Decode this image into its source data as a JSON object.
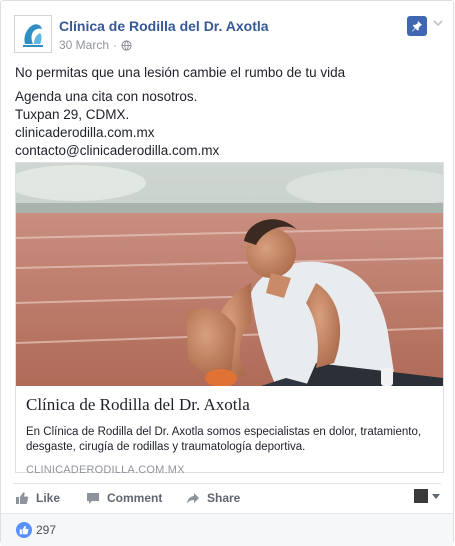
{
  "post": {
    "page_name": "Clínica de Rodilla del Dr. Axotla",
    "date": "30 March",
    "dot": "·",
    "audience_icon": "globe-icon",
    "lines": [
      "No permitas que una lesión cambie el rumbo de tu vida",
      "Agenda una cita con nosotros.",
      "Tuxpan 29, CDMX.",
      "clinicaderodilla.com.mx",
      "contacto@clinicaderodilla.com.mx"
    ]
  },
  "link_preview": {
    "image_subject": "athlete-on-track",
    "title": "Clínica de Rodilla del Dr. Axotla",
    "description": "En Clínica de Rodilla del Dr. Axotla somos especialistas en dolor, tratamiento, desgaste, cirugía de rodillas y traumatología deportiva.",
    "domain": "CLINICADERODILLA.COM.MX"
  },
  "actions": {
    "like": "Like",
    "comment": "Comment",
    "share": "Share"
  },
  "reactions": {
    "count": "297"
  },
  "colors": {
    "link_blue": "#365899",
    "accent_blue": "#4267b2",
    "reaction_blue": "#5890ff",
    "muted": "#90949c"
  }
}
